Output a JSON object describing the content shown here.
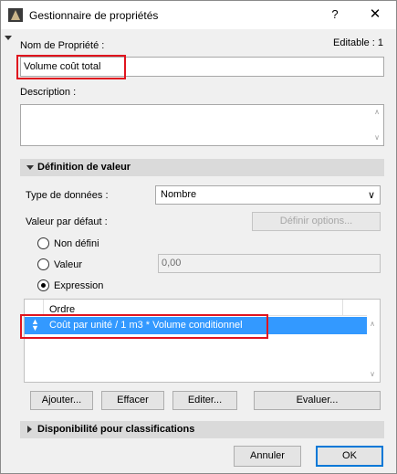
{
  "window": {
    "title": "Gestionnaire de propriétés",
    "help": "?",
    "close": "✕"
  },
  "property": {
    "name_label": "Nom de Propriété :",
    "editable": "Editable : 1",
    "name_value": "Volume coût total",
    "description_label": "Description :",
    "description_value": ""
  },
  "definition": {
    "title": "Définition de valeur",
    "data_type_label": "Type de données :",
    "data_type_value": "Nombre",
    "default_label": "Valeur par défaut :",
    "options_button": "Définir options...",
    "radio_undefined": "Non défini",
    "radio_value": "Valeur",
    "value_field": "0,00",
    "radio_expression": "Expression",
    "selected_radio": "Expression",
    "list_header": "Ordre",
    "expression_row": "Coût par unité / 1 m3 * Volume conditionnel",
    "buttons": {
      "add": "Ajouter...",
      "delete": "Effacer",
      "edit": "Editer...",
      "evaluate": "Evaluer..."
    }
  },
  "availability": {
    "title": "Disponibilité pour classifications"
  },
  "footer": {
    "cancel": "Annuler",
    "ok": "OK"
  }
}
